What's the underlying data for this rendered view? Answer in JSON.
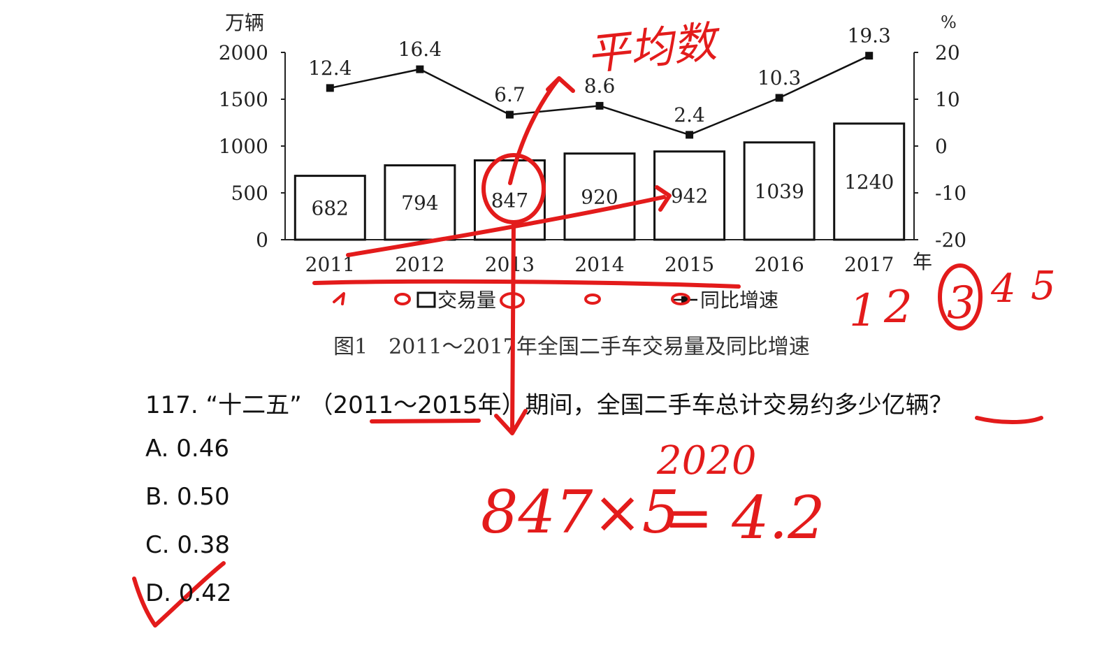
{
  "chart_data": {
    "type": "bar",
    "categories": [
      "2011",
      "2012",
      "2013",
      "2014",
      "2015",
      "2016",
      "2017"
    ],
    "x_unit": "年",
    "series": [
      {
        "name": "交易量",
        "type": "bar",
        "axis": "left",
        "values": [
          682,
          794,
          847,
          920,
          942,
          1039,
          1240
        ]
      },
      {
        "name": "同比增速",
        "type": "line",
        "axis": "right",
        "values": [
          12.4,
          16.4,
          6.7,
          8.6,
          2.4,
          10.3,
          19.3
        ]
      }
    ],
    "y_left": {
      "unit": "万辆",
      "range": [
        0,
        2000
      ],
      "ticks": [
        0,
        500,
        1000,
        1500,
        2000
      ]
    },
    "y_right": {
      "unit": "%",
      "range": [
        -20,
        20
      ],
      "ticks": [
        20,
        10,
        0,
        -10,
        -20
      ]
    },
    "value_labels": {
      "bars": [
        "682",
        "794",
        "847",
        "920",
        "942",
        "1039",
        "1240"
      ],
      "line": [
        "12.4",
        "16.4",
        "6.7",
        "8.6",
        "2.4",
        "10.3",
        "19.3"
      ]
    },
    "caption": "图1　2011～2017年全国二手车交易量及同比增速",
    "legend_position": "bottom"
  },
  "question": {
    "text": "117. “十二五” （2011～2015年）期间，全国二手车总计交易约多少亿辆？",
    "options": [
      "A. 0.46",
      "B. 0.50",
      "C. 0.38",
      "D. 0.42"
    ]
  },
  "annotations": {
    "handwriting_word": "平均数",
    "sequence_digits": [
      "1",
      "2",
      "3",
      "4",
      "5"
    ],
    "formula_main": "847×5",
    "formula_superscript": "2020",
    "formula_result": "= 4.2"
  },
  "colors": {
    "ink": "#e31b1b",
    "text": "#111111",
    "background": "#ffffff"
  }
}
